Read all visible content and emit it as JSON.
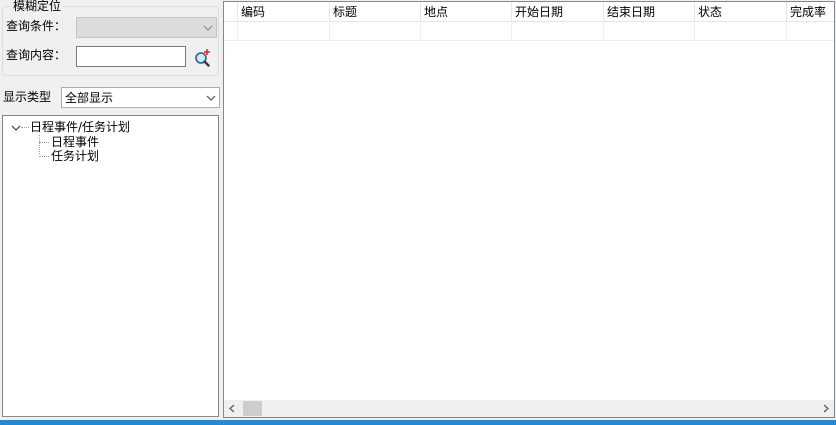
{
  "fuzzy_locate": {
    "caption": "模糊定位",
    "condition_label": "查询条件：",
    "condition_value": "",
    "content_label": "查询内容：",
    "content_value": "",
    "search_icon": "search-magnifier-icon"
  },
  "display_type": {
    "label": "显示类型",
    "selected": "全部显示"
  },
  "tree": {
    "root": {
      "label": "日程事件/任务计划",
      "expanded": true,
      "children": [
        {
          "label": "日程事件"
        },
        {
          "label": "任务计划"
        }
      ]
    }
  },
  "grid": {
    "columns": [
      "编码",
      "标题",
      "地点",
      "开始日期",
      "结束日期",
      "状态",
      "完成率"
    ],
    "rows": []
  },
  "colors": {
    "background": "#f0f0f0",
    "border": "#828790",
    "accent_bar": "#1e8bd3",
    "disabled_combo": "#dcdcdc"
  }
}
